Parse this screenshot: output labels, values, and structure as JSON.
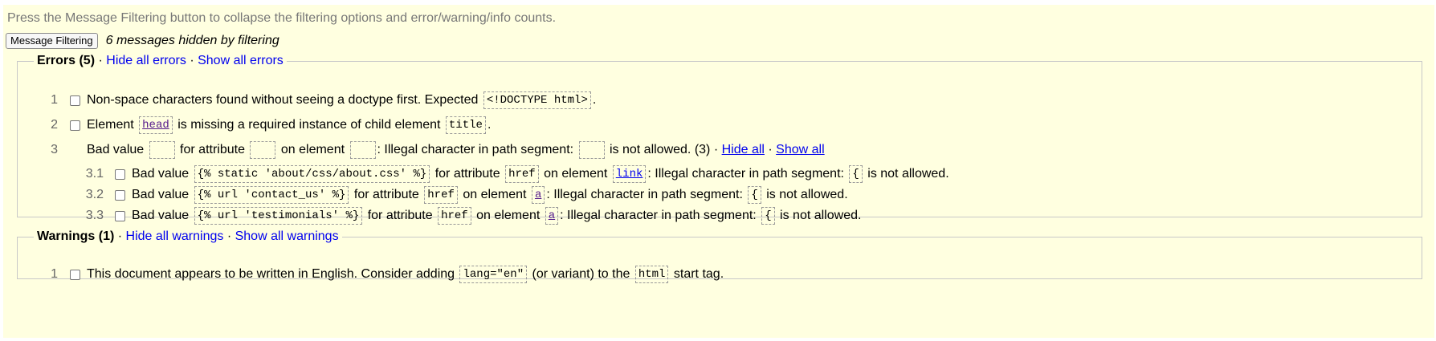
{
  "intro_text": "Press the Message Filtering button to collapse the filtering options and error/warning/info counts.",
  "filter_button_label": "Message Filtering",
  "hidden_message": "6 messages hidden by filtering",
  "errors": {
    "title": "Errors (5)",
    "sep": "·",
    "hide_all": "Hide all errors",
    "show_all": "Show all errors",
    "items": [
      {
        "num": "1",
        "t1": "Non-space characters found without seeing a doctype first. Expected ",
        "c1": "<!DOCTYPE html>",
        "t2": "."
      },
      {
        "num": "2",
        "t1": "Element ",
        "c1": "head",
        "t2": " is missing a required instance of child element ",
        "c2": "title",
        "t3": "."
      },
      {
        "num": "3",
        "t1": "Bad value ",
        "t2": " for attribute ",
        "t3": " on element ",
        "t4": ": Illegal character in path segment: ",
        "t5": " is not allowed. (3) · ",
        "hide_all": "Hide all",
        "sep": " · ",
        "show_all": "Show all"
      }
    ],
    "subitems": [
      {
        "num": "3.1",
        "t1": "Bad value ",
        "c1": "{% static 'about/css/about.css' %}",
        "t2": " for attribute ",
        "c2": "href",
        "t3": " on element ",
        "c3": "link",
        "t4": ": Illegal character in path segment: ",
        "c4": "{",
        "t5": " is not allowed."
      },
      {
        "num": "3.2",
        "t1": "Bad value ",
        "c1": "{% url 'contact_us' %}",
        "t2": " for attribute ",
        "c2": "href",
        "t3": " on element ",
        "c3": "a",
        "t4": ": Illegal character in path segment: ",
        "c4": "{",
        "t5": " is not allowed."
      },
      {
        "num": "3.3",
        "t1": "Bad value ",
        "c1": "{% url 'testimonials' %}",
        "t2": " for attribute ",
        "c2": "href",
        "t3": " on element ",
        "c3": "a",
        "t4": ": Illegal character in path segment: ",
        "c4": "{",
        "t5": " is not allowed."
      }
    ]
  },
  "warnings": {
    "title": "Warnings (1)",
    "sep": "·",
    "hide_all": "Hide all warnings",
    "show_all": "Show all warnings",
    "items": [
      {
        "num": "1",
        "t1": "This document appears to be written in English. Consider adding ",
        "c1": "lang=\"en\"",
        "t2": " (or variant) to the ",
        "c2": "html",
        "t3": " start tag."
      }
    ]
  },
  "colors": {
    "panel_bg": "#ffffe0",
    "link": "#0000ee",
    "visited_link": "#551a8b",
    "muted_text": "#777777"
  }
}
